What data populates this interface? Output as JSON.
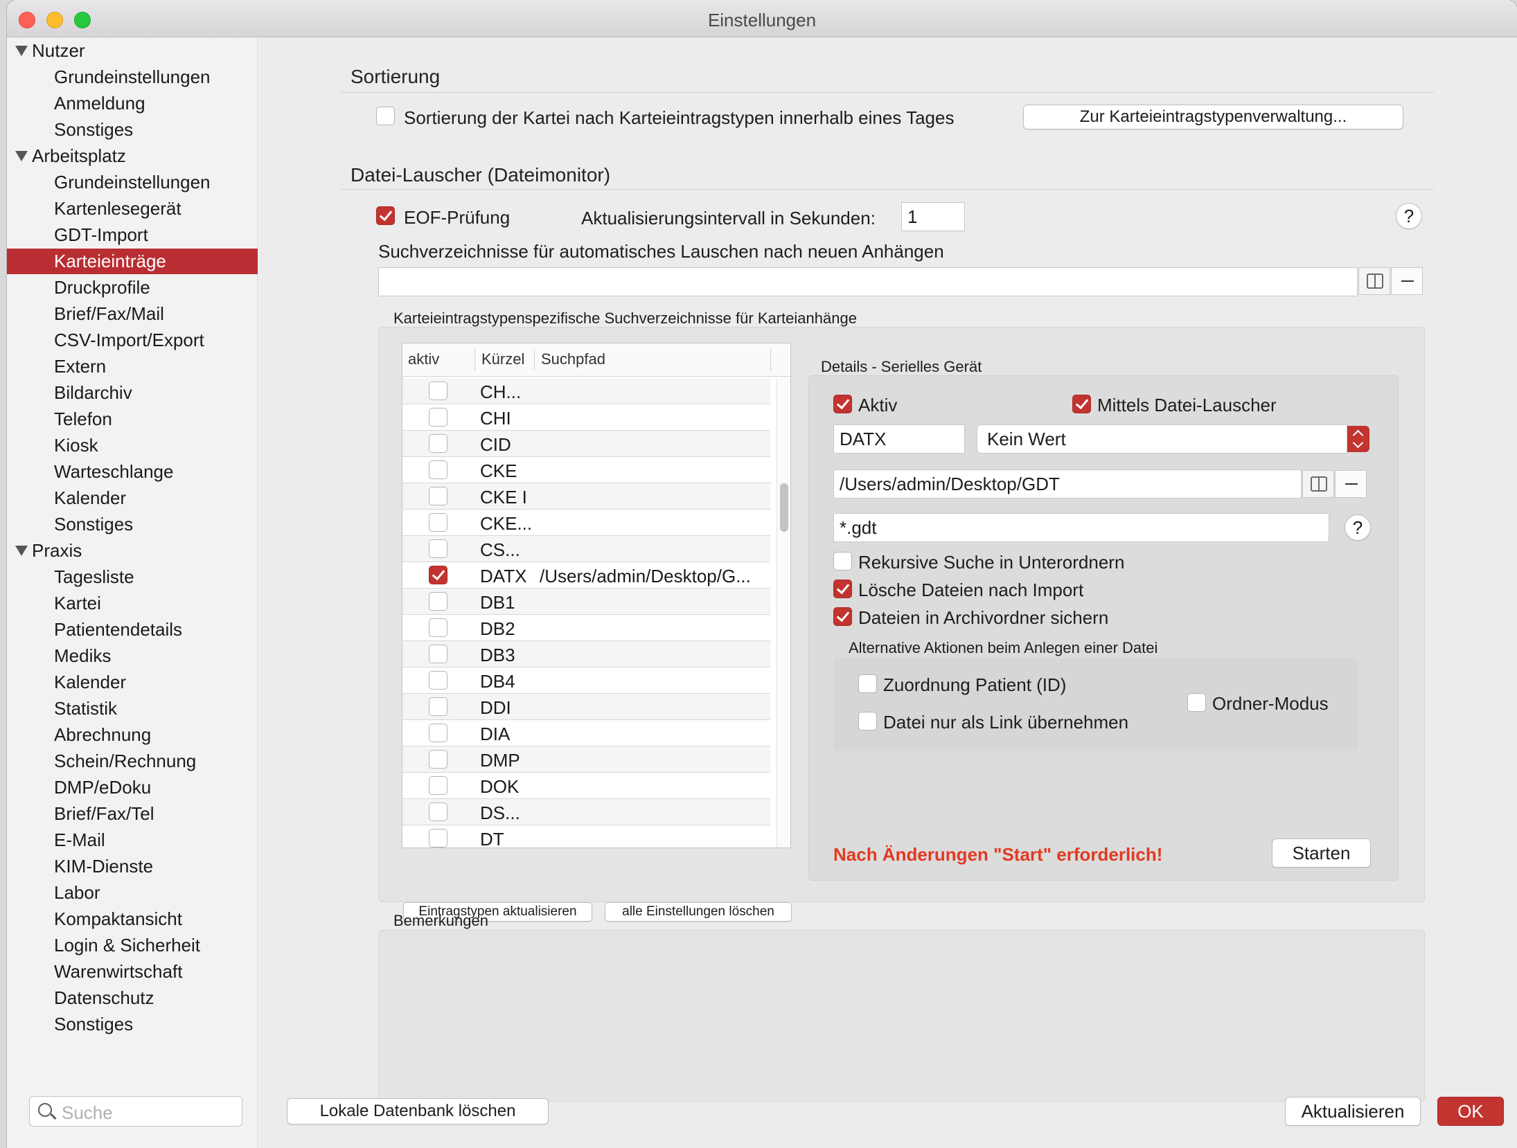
{
  "window": {
    "title": "Einstellungen"
  },
  "sidebar": {
    "groups": [
      {
        "label": "Nutzer"
      },
      {
        "label": "Arbeitsplatz"
      },
      {
        "label": "Praxis"
      }
    ],
    "items": [
      "Grundeinstellungen",
      "Anmeldung",
      "Sonstiges",
      "Grundeinstellungen",
      "Kartenlesegerät",
      "GDT-Import",
      "Karteieinträge",
      "Druckprofile",
      "Brief/Fax/Mail",
      "CSV-Import/Export",
      "Extern",
      "Bildarchiv",
      "Telefon",
      "Kiosk",
      "Warteschlange",
      "Kalender",
      "Sonstiges",
      "Tagesliste",
      "Kartei",
      "Patientendetails",
      "Mediks",
      "Kalender",
      "Statistik",
      "Abrechnung",
      "Schein/Rechnung",
      "DMP/eDoku",
      "Brief/Fax/Tel",
      "E-Mail",
      "KIM-Dienste",
      "Labor",
      "Kompaktansicht",
      "Login & Sicherheit",
      "Warenwirtschaft",
      "Datenschutz",
      "Sonstiges"
    ],
    "selected": "Karteieinträge",
    "search_placeholder": "Suche"
  },
  "sorting": {
    "heading": "Sortierung",
    "checkbox_label": "Sortierung der Kartei nach Karteieintragstypen innerhalb eines Tages",
    "checked": false,
    "button": "Zur Karteieintragstypenverwaltung..."
  },
  "monitor": {
    "heading": "Datei-Lauscher (Dateimonitor)",
    "eof_label": "EOF-Prüfung",
    "eof_checked": true,
    "interval_label": "Aktualisierungsintervall in Sekunden:",
    "interval_value": "1",
    "help": "?",
    "search_dirs_label": "Suchverzeichnisse für automatisches Lauschen nach neuen Anhängen",
    "search_dirs_value": ""
  },
  "typedirs": {
    "title": "Karteieintragstypenspezifische Suchverzeichnisse für Karteianhänge",
    "columns": [
      "aktiv",
      "Kürzel",
      "Suchpfad"
    ],
    "rows": [
      {
        "code": "CH...",
        "path": "",
        "active": false
      },
      {
        "code": "CHI",
        "path": "",
        "active": false
      },
      {
        "code": "CID",
        "path": "",
        "active": false
      },
      {
        "code": "CKE",
        "path": "",
        "active": false
      },
      {
        "code": "CKE I",
        "path": "",
        "active": false
      },
      {
        "code": "CKE...",
        "path": "",
        "active": false
      },
      {
        "code": "CS...",
        "path": "",
        "active": false
      },
      {
        "code": "DATX",
        "path": "/Users/admin/Desktop/G...",
        "active": true
      },
      {
        "code": "DB1",
        "path": "",
        "active": false
      },
      {
        "code": "DB2",
        "path": "",
        "active": false
      },
      {
        "code": "DB3",
        "path": "",
        "active": false
      },
      {
        "code": "DB4",
        "path": "",
        "active": false
      },
      {
        "code": "DDI",
        "path": "",
        "active": false
      },
      {
        "code": "DIA",
        "path": "",
        "active": false
      },
      {
        "code": "DMP",
        "path": "",
        "active": false
      },
      {
        "code": "DOK",
        "path": "",
        "active": false
      },
      {
        "code": "DS...",
        "path": "",
        "active": false
      },
      {
        "code": "DT",
        "path": "",
        "active": false
      }
    ],
    "btn_update": "Eintragstypen aktualisieren",
    "btn_clear": "alle Einstellungen löschen"
  },
  "details": {
    "title": "Details - Serielles Gerät",
    "aktiv_label": "Aktiv",
    "aktiv_checked": true,
    "lauscher_label": "Mittels Datei-Lauscher",
    "lauscher_checked": true,
    "code_value": "DATX",
    "select_value": "Kein Wert",
    "path_value": "/Users/admin/Desktop/GDT",
    "pattern_value": "*.gdt",
    "help": "?",
    "opt_recursive": "Rekursive Suche in Unterordnern",
    "opt_recursive_checked": false,
    "opt_delete": "Lösche Dateien nach Import",
    "opt_delete_checked": true,
    "opt_archive": "Dateien in Archivordner sichern",
    "opt_archive_checked": true,
    "alt_title": "Alternative Aktionen beim Anlegen einer Datei",
    "alt_patient": "Zuordnung Patient (ID)",
    "alt_link": "Datei nur als Link übernehmen",
    "alt_folder": "Ordner-Modus",
    "warning": "Nach Änderungen \"Start\" erforderlich!",
    "start_button": "Starten"
  },
  "remarks": {
    "title": "Bemerkungen",
    "value": ""
  },
  "footer": {
    "delete_db": "Lokale Datenbank löschen",
    "refresh": "Aktualisieren",
    "ok": "OK"
  },
  "colors": {
    "accent": "#c2342f",
    "selection": "#b92e33",
    "warning": "#e23a22"
  }
}
